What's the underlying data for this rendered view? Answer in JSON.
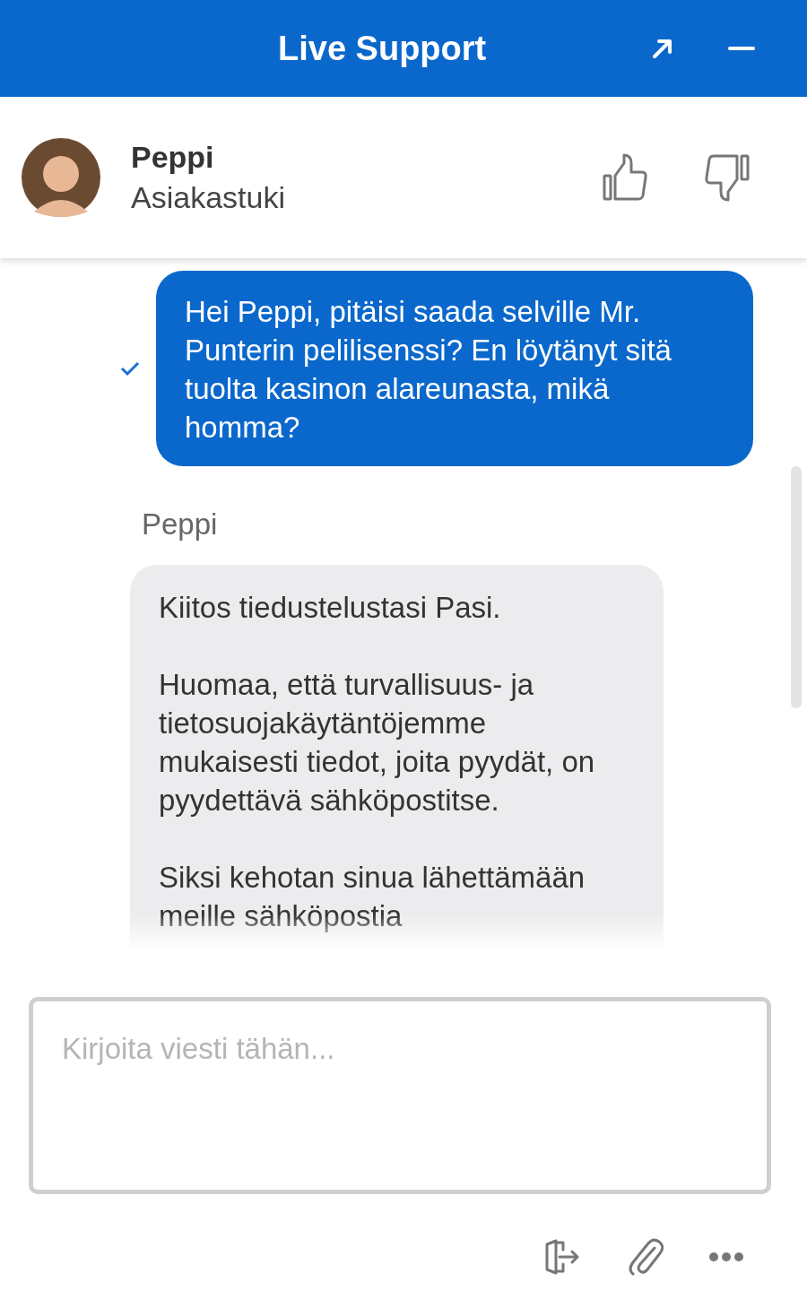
{
  "window": {
    "title": "Live Support"
  },
  "agent": {
    "name": "Peppi",
    "role": "Asiakastuki"
  },
  "messages": [
    {
      "kind": "outgoing",
      "delivered": true,
      "paragraphs": [
        "Hei Peppi, pitäisi saada selville Mr. Punterin pelilisenssi? En löytänyt sitä tuolta kasinon alareunasta, mikä homma?"
      ]
    },
    {
      "kind": "incoming",
      "sender": "Peppi",
      "paragraphs": [
        "Kiitos tiedustelustasi Pasi.",
        "Huomaa, että turvallisuus- ja tietosuojakäytäntöjemme mukaisesti tiedot, joita pyydät, on pyydettävä sähköpostitse.",
        "Siksi kehotan sinua lähettämään meille sähköpostia"
      ]
    }
  ],
  "composer": {
    "placeholder": "Kirjoita viesti tähän..."
  }
}
